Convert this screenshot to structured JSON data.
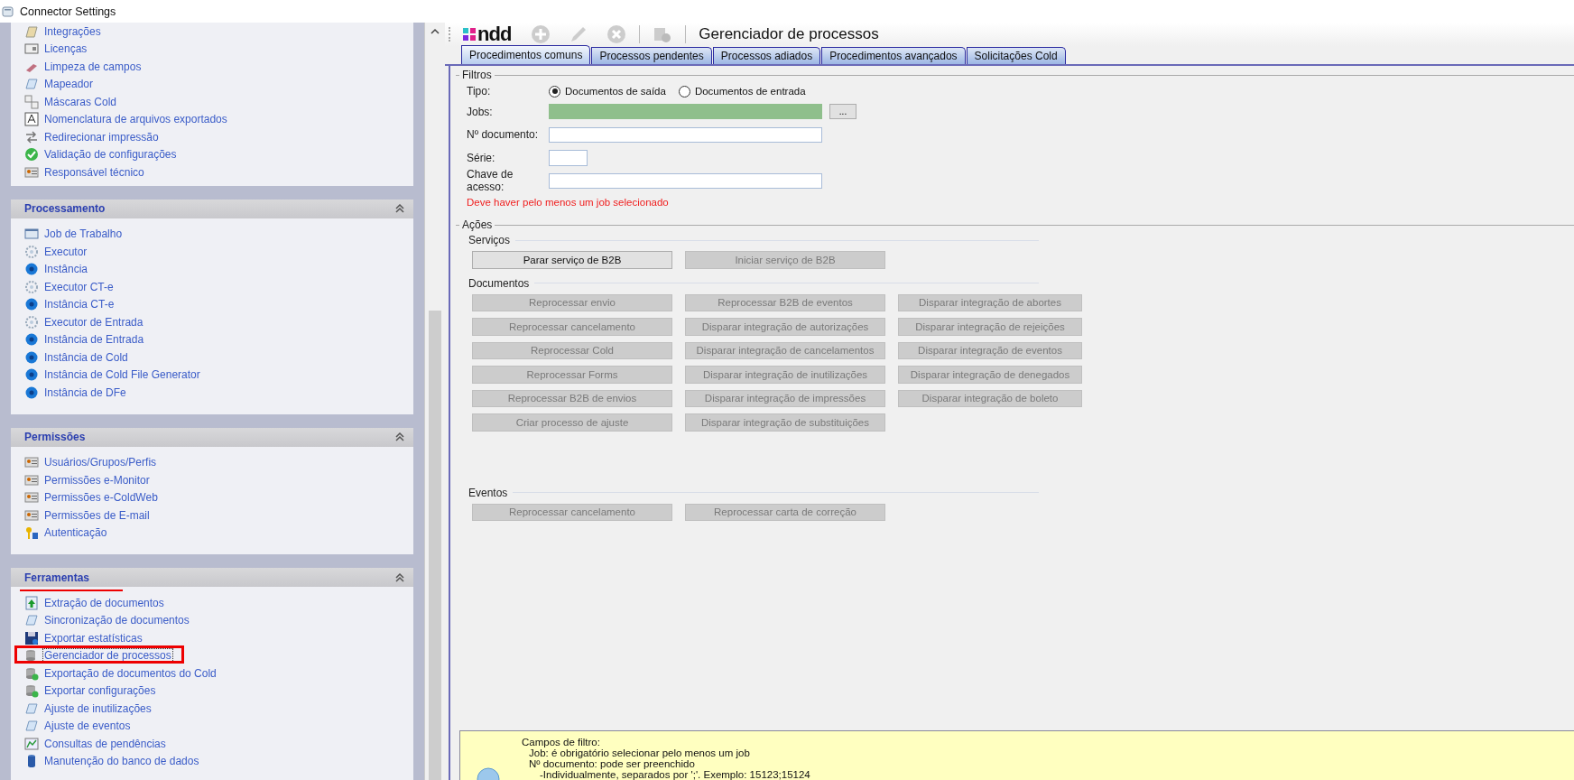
{
  "window": {
    "title": "Connector Settings"
  },
  "sidebar": {
    "sections": [
      {
        "items": [
          {
            "label": "Integrações",
            "selected": false
          },
          {
            "label": "Licenças",
            "selected": false
          },
          {
            "label": "Limpeza de campos",
            "selected": false
          },
          {
            "label": "Mapeador",
            "selected": false
          },
          {
            "label": "Máscaras Cold",
            "selected": false
          },
          {
            "label": "Nomenclatura de arquivos exportados",
            "selected": false
          },
          {
            "label": "Redirecionar impressão",
            "selected": false
          },
          {
            "label": "Validação de configurações",
            "selected": false
          },
          {
            "label": "Responsável técnico",
            "selected": false
          }
        ]
      },
      {
        "title": "Processamento",
        "underlined": false,
        "items": [
          {
            "label": "Job de Trabalho",
            "selected": false
          },
          {
            "label": "Executor",
            "selected": false
          },
          {
            "label": "Instância",
            "selected": false
          },
          {
            "label": "Executor CT-e",
            "selected": false
          },
          {
            "label": "Instância CT-e",
            "selected": false
          },
          {
            "label": "Executor de Entrada",
            "selected": false
          },
          {
            "label": "Instância de Entrada",
            "selected": false
          },
          {
            "label": "Instância de Cold",
            "selected": false
          },
          {
            "label": "Instância de Cold File Generator",
            "selected": false
          },
          {
            "label": "Instância de DFe",
            "selected": false
          }
        ]
      },
      {
        "title": "Permissões",
        "underlined": false,
        "items": [
          {
            "label": "Usuários/Grupos/Perfis",
            "selected": false
          },
          {
            "label": "Permissões e-Monitor",
            "selected": false
          },
          {
            "label": "Permissões e-ColdWeb",
            "selected": false
          },
          {
            "label": "Permissões de E-mail",
            "selected": false
          },
          {
            "label": "Autenticação",
            "selected": false
          }
        ]
      },
      {
        "title": "Ferramentas",
        "underlined": true,
        "items": [
          {
            "label": "Extração de documentos",
            "selected": false
          },
          {
            "label": "Sincronização de documentos",
            "selected": false
          },
          {
            "label": "Exportar estatísticas",
            "selected": false
          },
          {
            "label": "Gerenciador de processos",
            "selected": true
          },
          {
            "label": "Exportação de documentos do Cold",
            "selected": false
          },
          {
            "label": "Exportar configurações",
            "selected": false
          },
          {
            "label": "Ajuste de inutilizações",
            "selected": false
          },
          {
            "label": "Ajuste de eventos",
            "selected": false
          },
          {
            "label": "Consultas de pendências",
            "selected": false
          },
          {
            "label": "Manutenção do banco de dados",
            "selected": false
          }
        ]
      }
    ]
  },
  "toolbar": {
    "logo": "ndd",
    "title": "Gerenciador de processos"
  },
  "tabs": [
    {
      "label": "Procedimentos comuns",
      "selected": true
    },
    {
      "label": "Processos pendentes",
      "selected": false
    },
    {
      "label": "Processos adiados",
      "selected": false
    },
    {
      "label": "Procedimentos avançados",
      "selected": false
    },
    {
      "label": "Solicitações Cold",
      "selected": false
    }
  ],
  "filters": {
    "title": "Filtros",
    "type_label": "Tipo:",
    "radios": [
      {
        "label": "Documentos de saída",
        "selected": true
      },
      {
        "label": "Documentos de entrada",
        "selected": false
      }
    ],
    "fields": [
      {
        "kind": "picker",
        "label": "Jobs:",
        "highlighted": true,
        "button": "..."
      },
      {
        "kind": "text",
        "label": "Nº documento:",
        "highlighted": false
      },
      {
        "kind": "short",
        "label": "Série:",
        "highlighted": false
      },
      {
        "kind": "text",
        "label": "Chave de acesso:",
        "highlighted": false
      }
    ],
    "error": "Deve haver pelo menos um job selecionado"
  },
  "actions": {
    "title": "Ações",
    "groups": [
      {
        "title": "Serviços",
        "buttons": [
          {
            "label": "Parar serviço de B2B",
            "disabled": false
          },
          {
            "label": "Iniciar serviço de B2B",
            "disabled": true
          }
        ]
      },
      {
        "title": "Documentos",
        "buttons": [
          {
            "label": "Reprocessar envio",
            "disabled": true
          },
          {
            "label": "Reprocessar B2B de eventos",
            "disabled": true
          },
          {
            "label": "Disparar integração de abortes",
            "disabled": true
          },
          {
            "label": "Reprocessar cancelamento",
            "disabled": true
          },
          {
            "label": "Disparar integração de autorizações",
            "disabled": true
          },
          {
            "label": "Disparar integração de rejeições",
            "disabled": true
          },
          {
            "label": "Reprocessar Cold",
            "disabled": true
          },
          {
            "label": "Disparar integração de cancelamentos",
            "disabled": true
          },
          {
            "label": "Disparar integração de eventos",
            "disabled": true
          },
          {
            "label": "Reprocessar Forms",
            "disabled": true
          },
          {
            "label": "Disparar integração de inutilizações",
            "disabled": true
          },
          {
            "label": "Disparar integração de denegados",
            "disabled": true
          },
          {
            "label": "Reprocessar B2B de envios",
            "disabled": true
          },
          {
            "label": "Disparar integração de impressões",
            "disabled": true
          },
          {
            "label": "Disparar integração de boleto",
            "disabled": true
          },
          {
            "label": "Criar processo de ajuste",
            "disabled": true
          },
          {
            "label": "Disparar integração de substituições",
            "disabled": true
          }
        ]
      },
      {
        "title": "Eventos",
        "buttons": [
          {
            "label": "Reprocessar cancelamento",
            "disabled": true
          },
          {
            "label": "Reprocessar carta de correção",
            "disabled": true
          }
        ]
      }
    ]
  },
  "help": {
    "text": "Campos de filtro:",
    "children": [
      {
        "text": "Job: é obrigatório selecionar pelo menos um job"
      },
      {
        "text": "Nº documento: pode ser preenchido",
        "children": [
          {
            "text": "-Individualmente, separados por ';'. Exemplo: 15123;15124"
          }
        ]
      }
    ]
  }
}
